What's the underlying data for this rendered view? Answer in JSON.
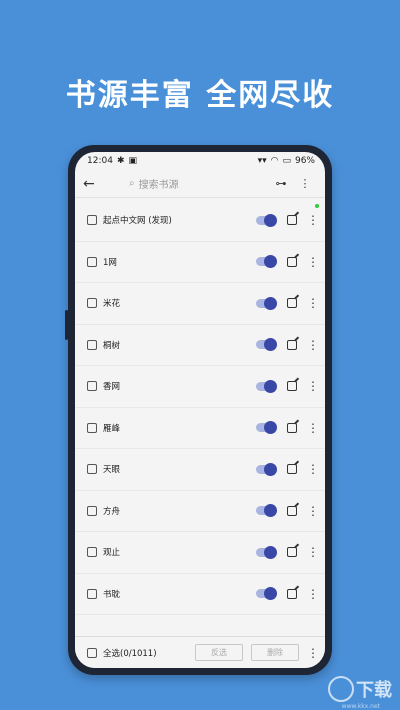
{
  "headline": "书源丰富  全网尽收",
  "status": {
    "time": "12:04",
    "battery": "96%"
  },
  "toolbar": {
    "search_placeholder": "搜索书源"
  },
  "sources": [
    {
      "name": "起点中文网 (发现)",
      "enabled": true
    },
    {
      "name": "1网",
      "enabled": true
    },
    {
      "name": "米花",
      "enabled": true
    },
    {
      "name": "桐树",
      "enabled": true
    },
    {
      "name": "香网",
      "enabled": true
    },
    {
      "name": "雁峰",
      "enabled": true
    },
    {
      "name": "天眼",
      "enabled": true
    },
    {
      "name": "方舟",
      "enabled": true
    },
    {
      "name": "观止",
      "enabled": true
    },
    {
      "name": "书耽",
      "enabled": true
    }
  ],
  "bottom": {
    "select_all": "全选(0/1011)",
    "invert": "反选",
    "delete": "删除"
  },
  "watermark": {
    "text": "下载",
    "sub": "www.kkx.net"
  },
  "colors": {
    "background": "#4a90d9",
    "toggle_on": "#3948a6"
  }
}
